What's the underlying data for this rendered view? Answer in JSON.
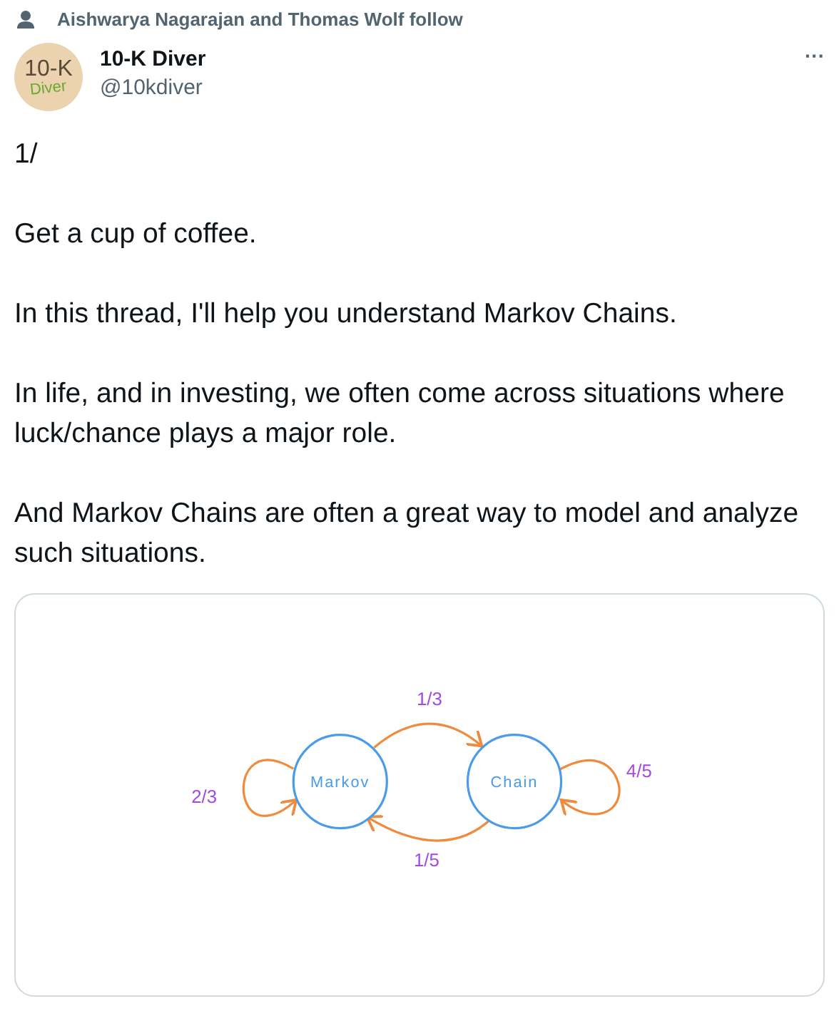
{
  "social_context": "Aishwarya Nagarajan and Thomas Wolf follow",
  "author": {
    "avatar_lines": [
      "10-K",
      "Diver"
    ],
    "name": "10-K Diver",
    "handle": "@10kdiver"
  },
  "more_button": "···",
  "paragraphs": [
    "1/",
    "Get a cup of coffee.",
    "In this thread, I'll help you understand Markov Chains.",
    "In life, and in investing, we often come across situations where luck/chance plays a major role.",
    "And Markov Chains are often a great way to model and analyze such situations."
  ],
  "diagram": {
    "nodes": [
      "Markov",
      "Chain"
    ],
    "edges": [
      {
        "kind": "forward",
        "label": "1/3"
      },
      {
        "kind": "backward",
        "label": "1/5"
      },
      {
        "kind": "self-left",
        "label": "2/3"
      },
      {
        "kind": "self-right",
        "label": "4/5"
      }
    ]
  }
}
